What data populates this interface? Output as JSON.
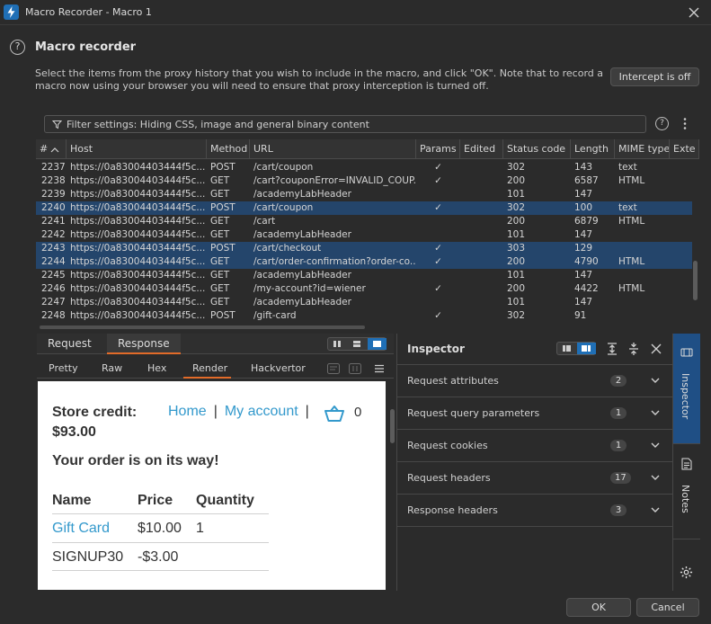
{
  "window": {
    "title": "Macro Recorder - Macro 1"
  },
  "header": {
    "heading": "Macro recorder",
    "description": "Select the items from the proxy history that you wish to include in the macro, and click \"OK\". Note that to record a macro now using your browser you will need to ensure that proxy interception is turned off.",
    "intercept_label": "Intercept is off"
  },
  "filter": {
    "text": "Filter settings: Hiding CSS, image and general binary content"
  },
  "table": {
    "columns": [
      "#",
      "Host",
      "Method",
      "URL",
      "Params",
      "Edited",
      "Status code",
      "Length",
      "MIME type",
      "Exte"
    ],
    "rows": [
      {
        "num": "2237",
        "host": "https://0a83004403444f5c...",
        "method": "POST",
        "url": "/cart/coupon",
        "params": "✓",
        "status": "302",
        "length": "143",
        "mime": "text",
        "selected": false
      },
      {
        "num": "2238",
        "host": "https://0a83004403444f5c...",
        "method": "GET",
        "url": "/cart?couponError=INVALID_COUP...",
        "params": "✓",
        "status": "200",
        "length": "6587",
        "mime": "HTML",
        "selected": false
      },
      {
        "num": "2239",
        "host": "https://0a83004403444f5c...",
        "method": "GET",
        "url": "/academyLabHeader",
        "params": "",
        "status": "101",
        "length": "147",
        "mime": "",
        "selected": false
      },
      {
        "num": "2240",
        "host": "https://0a83004403444f5c...",
        "method": "POST",
        "url": "/cart/coupon",
        "params": "✓",
        "status": "302",
        "length": "100",
        "mime": "text",
        "selected": true
      },
      {
        "num": "2241",
        "host": "https://0a83004403444f5c...",
        "method": "GET",
        "url": "/cart",
        "params": "",
        "status": "200",
        "length": "6879",
        "mime": "HTML",
        "selected": false
      },
      {
        "num": "2242",
        "host": "https://0a83004403444f5c...",
        "method": "GET",
        "url": "/academyLabHeader",
        "params": "",
        "status": "101",
        "length": "147",
        "mime": "",
        "selected": false
      },
      {
        "num": "2243",
        "host": "https://0a83004403444f5c...",
        "method": "POST",
        "url": "/cart/checkout",
        "params": "✓",
        "status": "303",
        "length": "129",
        "mime": "",
        "selected": true
      },
      {
        "num": "2244",
        "host": "https://0a83004403444f5c...",
        "method": "GET",
        "url": "/cart/order-confirmation?order-co...",
        "params": "✓",
        "status": "200",
        "length": "4790",
        "mime": "HTML",
        "selected": true
      },
      {
        "num": "2245",
        "host": "https://0a83004403444f5c...",
        "method": "GET",
        "url": "/academyLabHeader",
        "params": "",
        "status": "101",
        "length": "147",
        "mime": "",
        "selected": false
      },
      {
        "num": "2246",
        "host": "https://0a83004403444f5c...",
        "method": "GET",
        "url": "/my-account?id=wiener",
        "params": "✓",
        "status": "200",
        "length": "4422",
        "mime": "HTML",
        "selected": false
      },
      {
        "num": "2247",
        "host": "https://0a83004403444f5c...",
        "method": "GET",
        "url": "/academyLabHeader",
        "params": "",
        "status": "101",
        "length": "147",
        "mime": "",
        "selected": false
      },
      {
        "num": "2248",
        "host": "https://0a83004403444f5c...",
        "method": "POST",
        "url": "/gift-card",
        "params": "✓",
        "status": "302",
        "length": "91",
        "mime": "",
        "selected": false
      }
    ]
  },
  "message_tabs": {
    "request": "Request",
    "response": "Response"
  },
  "render_tabs": {
    "pretty": "Pretty",
    "raw": "Raw",
    "hex": "Hex",
    "render": "Render",
    "hackvertor": "Hackvertor"
  },
  "rendered": {
    "credit_label": "Store credit:",
    "credit_value": "$93.00",
    "nav_home": "Home",
    "nav_sep": "|",
    "nav_account": "My account",
    "cart_count": "0",
    "message": "Your order is on its way!",
    "headers": [
      "Name",
      "Price",
      "Quantity"
    ],
    "rows": [
      {
        "name": "Gift Card",
        "price": "$10.00",
        "qty": "1"
      },
      {
        "name": "SIGNUP30",
        "price": "-$3.00",
        "qty": ""
      }
    ]
  },
  "inspector": {
    "title": "Inspector",
    "sections": [
      {
        "label": "Request attributes",
        "count": "2"
      },
      {
        "label": "Request query parameters",
        "count": "1"
      },
      {
        "label": "Request cookies",
        "count": "1"
      },
      {
        "label": "Request headers",
        "count": "17"
      },
      {
        "label": "Response headers",
        "count": "3"
      }
    ]
  },
  "rail": {
    "inspector": "Inspector",
    "notes": "Notes"
  },
  "footer": {
    "ok": "OK",
    "cancel": "Cancel"
  },
  "colors": {
    "accent": "#e26b29",
    "selection": "#24456b",
    "link": "#3399cc",
    "active_rail": "#1f4f85"
  },
  "icons": [
    "burp-app-icon",
    "close-icon",
    "help-icon",
    "filter-icon",
    "kebab-menu-icon",
    "sort-ascending-icon",
    "cart-icon",
    "gear-icon",
    "notes-icon",
    "chevron-down-icon"
  ]
}
